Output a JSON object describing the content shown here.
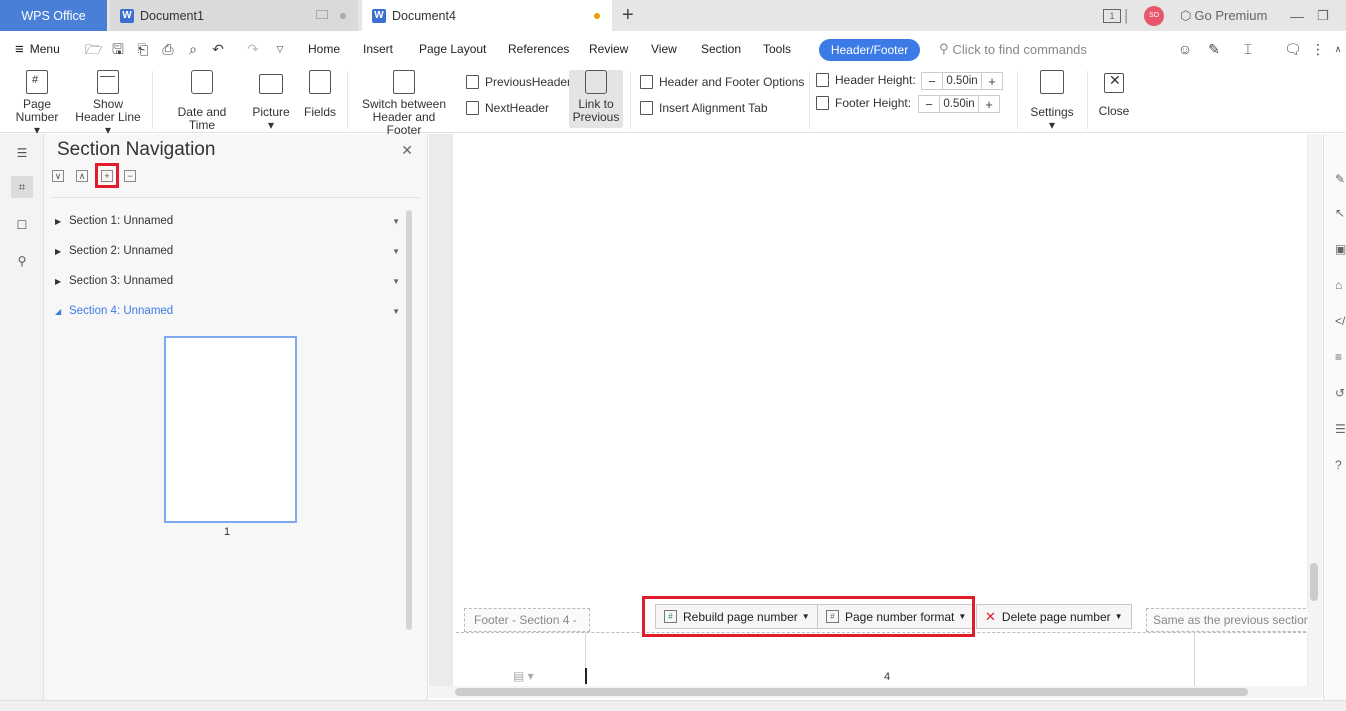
{
  "titlebar": {
    "app_tab": "WPS Office",
    "tabs": [
      {
        "label": "Document1"
      },
      {
        "label": "Document4"
      }
    ],
    "go_premium": "Go Premium",
    "avatar_initials": "SO"
  },
  "menubar": {
    "menu": "Menu",
    "items": [
      "Home",
      "Insert",
      "Page Layout",
      "References",
      "Review",
      "View",
      "Section",
      "Tools"
    ],
    "active_tab": "Header/Footer",
    "search_placeholder": "Click to find commands"
  },
  "ribbon": {
    "page_number": [
      "Page",
      "Number"
    ],
    "show_header_line": [
      "Show",
      "Header Line"
    ],
    "date_time": "Date and Time",
    "picture": "Picture",
    "fields": "Fields",
    "switch": [
      "Switch between",
      "Header and Footer"
    ],
    "previous_header": "PreviousHeader",
    "next_header": "NextHeader",
    "link_prev": [
      "Link to",
      "Previous"
    ],
    "hf_options": "Header and Footer Options",
    "insert_align_tab": "Insert Alignment Tab",
    "header_height_label": "Header Height:",
    "header_height_value": "0.50in",
    "footer_height_label": "Footer Height:",
    "footer_height_value": "0.50in",
    "settings": "Settings",
    "close": "Close"
  },
  "nav": {
    "title": "Section Navigation",
    "sections": [
      {
        "label": "Section 1: Unnamed"
      },
      {
        "label": "Section 2: Unnamed"
      },
      {
        "label": "Section 3: Unnamed"
      },
      {
        "label": "Section 4: Unnamed"
      }
    ],
    "thumb_page": "1"
  },
  "doc": {
    "footer_label": "Footer  - Section 4 -",
    "same_as_prev": "Same as the previous section",
    "rebuild": "Rebuild page number",
    "format": "Page number format",
    "delete": "Delete page number",
    "page_number": "4"
  },
  "colors": {
    "accent": "#3c7be5",
    "highlight": "#e21d2a",
    "wps_tab": "#4a7fd8"
  }
}
